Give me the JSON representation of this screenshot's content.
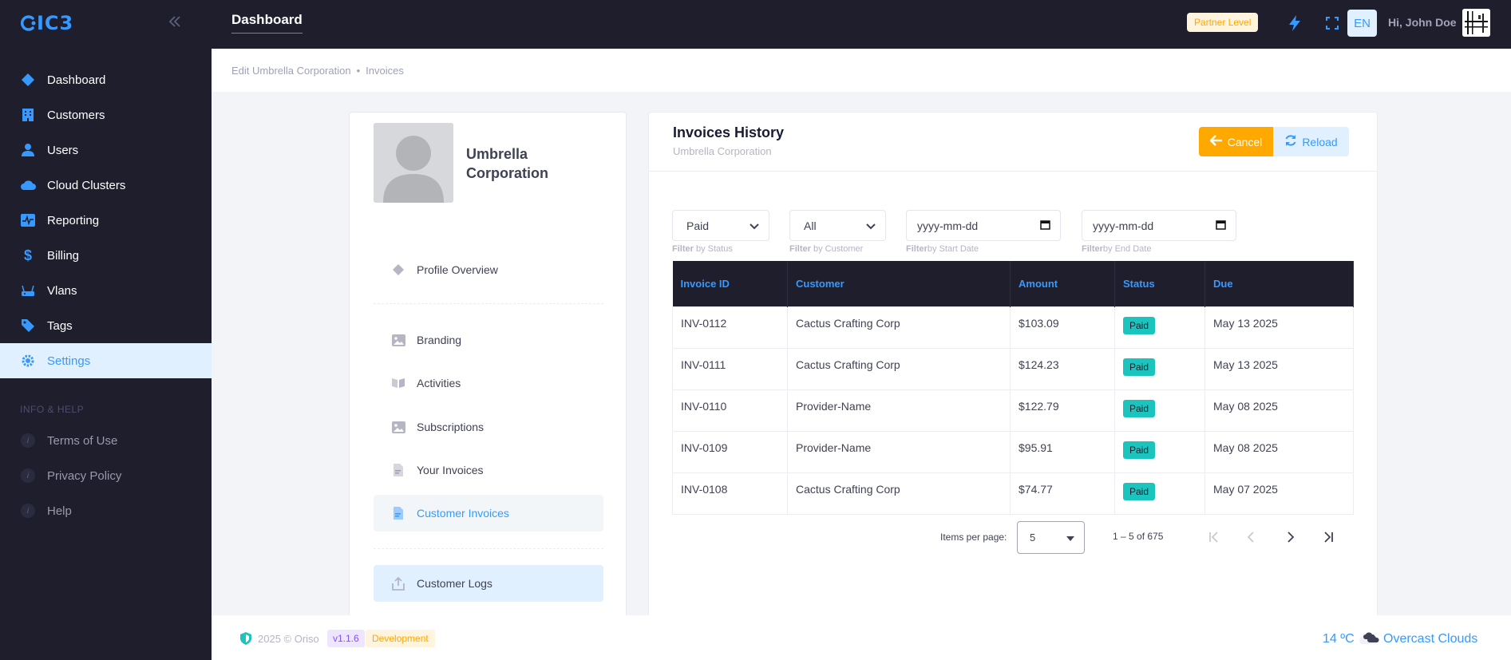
{
  "app": {
    "logo_text": "IC3"
  },
  "sidebar": {
    "items": [
      {
        "label": "Dashboard",
        "icon": "layers-icon"
      },
      {
        "label": "Customers",
        "icon": "building-icon"
      },
      {
        "label": "Users",
        "icon": "user-icon"
      },
      {
        "label": "Cloud Clusters",
        "icon": "cloud-icon"
      },
      {
        "label": "Reporting",
        "icon": "chart-icon"
      },
      {
        "label": "Billing",
        "icon": "dollar-icon"
      },
      {
        "label": "Vlans",
        "icon": "router-icon"
      },
      {
        "label": "Tags",
        "icon": "tag-icon"
      },
      {
        "label": "Settings",
        "icon": "gear-icon",
        "active": true
      }
    ],
    "section_title": "INFO & HELP",
    "help_items": [
      {
        "label": "Terms of Use"
      },
      {
        "label": "Privacy Policy"
      },
      {
        "label": "Help"
      }
    ]
  },
  "header": {
    "title": "Dashboard",
    "partner_badge": "Partner Level",
    "lang": "EN",
    "greeting": "Hi, John Doe"
  },
  "breadcrumb": {
    "parent": "Edit Umbrella Corporation",
    "separator": "•",
    "current": "Invoices"
  },
  "profile": {
    "name": "Umbrella Corporation",
    "nav": [
      {
        "label": "Profile Overview",
        "icon": "diamond-icon"
      },
      {
        "label": "Branding",
        "icon": "image-icon"
      },
      {
        "label": "Activities",
        "icon": "book-icon"
      },
      {
        "label": "Subscriptions",
        "icon": "image-icon"
      },
      {
        "label": "Your Invoices",
        "icon": "document-icon"
      },
      {
        "label": "Customer Invoices",
        "icon": "document-icon",
        "selected": true
      },
      {
        "label": "Customer Logs",
        "icon": "upload-icon",
        "highlighted": true
      }
    ]
  },
  "invoices": {
    "title": "Invoices History",
    "subtitle": "Umbrella Corporation",
    "cancel_label": "Cancel",
    "reload_label": "Reload",
    "filters": {
      "status_value": "Paid",
      "status_hint_b": "Filter",
      "status_hint": " by Status",
      "customer_value": "All",
      "customer_hint_b": "Filter",
      "customer_hint": " by Customer",
      "start_placeholder": "yyyy-mm-dd",
      "start_hint_b": "Filter",
      "start_hint": "by Start Date",
      "end_placeholder": "yyyy-mm-dd",
      "end_hint_b": "Filter",
      "end_hint": "by End Date"
    },
    "columns": [
      "Invoice ID",
      "Customer",
      "Amount",
      "Status",
      "Due"
    ],
    "rows": [
      {
        "id": "INV-0112",
        "customer": "Cactus Crafting Corp",
        "amount": "$103.09",
        "status": "Paid",
        "due": "May 13 2025"
      },
      {
        "id": "INV-0111",
        "customer": "Cactus Crafting Corp",
        "amount": "$124.23",
        "status": "Paid",
        "due": "May 13 2025"
      },
      {
        "id": "INV-0110",
        "customer": "Provider-Name",
        "amount": "$122.79",
        "status": "Paid",
        "due": "May 08 2025"
      },
      {
        "id": "INV-0109",
        "customer": "Provider-Name",
        "amount": "$95.91",
        "status": "Paid",
        "due": "May 08 2025"
      },
      {
        "id": "INV-0108",
        "customer": "Cactus Crafting Corp",
        "amount": "$74.77",
        "status": "Paid",
        "due": "May 07 2025"
      }
    ],
    "pager": {
      "label": "Items per page:",
      "page_size": "5",
      "range": "1 – 5 of 675"
    }
  },
  "footer": {
    "copyright": "2025 © Oriso",
    "version": "v1.1.6",
    "environment": "Development",
    "temperature": "14 ºC",
    "weather": "Overcast Clouds"
  },
  "colors": {
    "sidebar_bg": "#1e1e2d",
    "accent": "#3699ff",
    "warning": "#ffa800",
    "success": "#1bc5bd"
  }
}
